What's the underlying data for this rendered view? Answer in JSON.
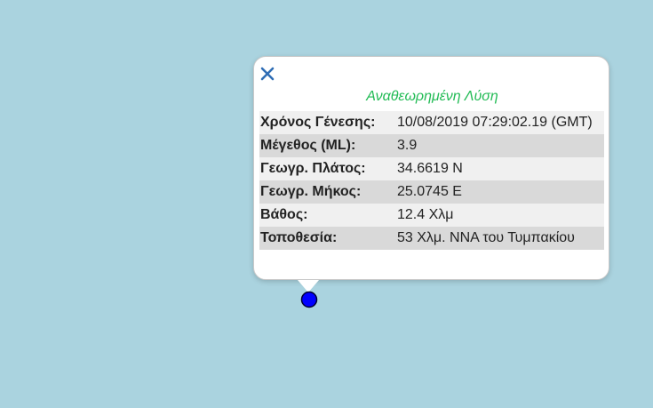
{
  "map": {
    "background_color": "#aad3df",
    "marker_color": "#0000ff",
    "marker_stroke": "#000033"
  },
  "popup": {
    "close_icon": "close-icon",
    "title": "Αναθεωρημένη Λύση",
    "title_color": "#22bb55",
    "rows": [
      {
        "label": "Χρόνος Γένεσης:",
        "value": "10/08/2019 07:29:02.19 (GMT)"
      },
      {
        "label": "Μέγεθος (ML):",
        "value": "3.9"
      },
      {
        "label": "Γεωγρ. Πλάτος:",
        "value": "34.6619 N"
      },
      {
        "label": "Γεωγρ. Μήκος:",
        "value": "25.0745 E"
      },
      {
        "label": "Βάθος:",
        "value": "12.4 Χλμ"
      },
      {
        "label": "Τοποθεσία:",
        "value": "53 Χλμ. ΝΝΑ του Τυμπακίου"
      }
    ]
  }
}
